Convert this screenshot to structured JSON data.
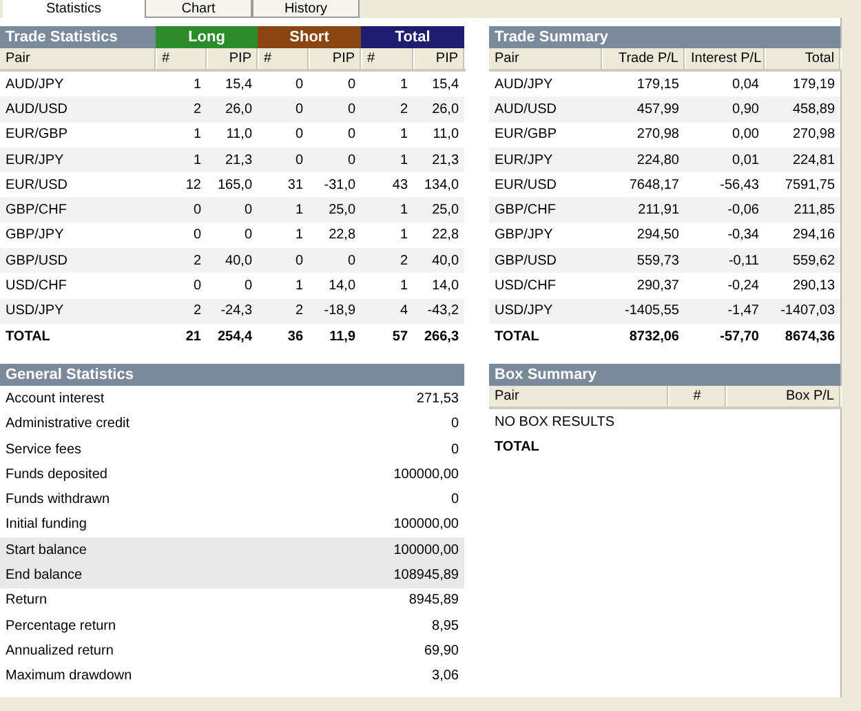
{
  "tabs": [
    {
      "label": "Statistics",
      "selected": true
    },
    {
      "label": "Chart",
      "selected": false
    },
    {
      "label": "History",
      "selected": false
    }
  ],
  "trade_statistics": {
    "title": "Trade Statistics",
    "groups": [
      {
        "label": "Long",
        "color": "#2a8c2a"
      },
      {
        "label": "Short",
        "color": "#8b4513"
      },
      {
        "label": "Total",
        "color": "#1e1e70"
      }
    ],
    "columns": [
      "Pair",
      "#",
      "PIP",
      "#",
      "PIP",
      "#",
      "PIP"
    ],
    "rows": [
      {
        "cells": [
          "AUD/JPY",
          "1",
          "15,4",
          "0",
          "0",
          "1",
          "15,4"
        ]
      },
      {
        "cells": [
          "AUD/USD",
          "2",
          "26,0",
          "0",
          "0",
          "2",
          "26,0"
        ]
      },
      {
        "cells": [
          "EUR/GBP",
          "1",
          "11,0",
          "0",
          "0",
          "1",
          "11,0"
        ]
      },
      {
        "cells": [
          "EUR/JPY",
          "1",
          "21,3",
          "0",
          "0",
          "1",
          "21,3"
        ]
      },
      {
        "cells": [
          "EUR/USD",
          "12",
          "165,0",
          "31",
          "-31,0",
          "43",
          "134,0"
        ]
      },
      {
        "cells": [
          "GBP/CHF",
          "0",
          "0",
          "1",
          "25,0",
          "1",
          "25,0"
        ]
      },
      {
        "cells": [
          "GBP/JPY",
          "0",
          "0",
          "1",
          "22,8",
          "1",
          "22,8"
        ]
      },
      {
        "cells": [
          "GBP/USD",
          "2",
          "40,0",
          "0",
          "0",
          "2",
          "40,0"
        ]
      },
      {
        "cells": [
          "USD/CHF",
          "0",
          "0",
          "1",
          "14,0",
          "1",
          "14,0"
        ]
      },
      {
        "cells": [
          "USD/JPY",
          "2",
          "-24,3",
          "2",
          "-18,9",
          "4",
          "-43,2"
        ]
      }
    ],
    "total": [
      "TOTAL",
      "21",
      "254,4",
      "36",
      "11,9",
      "57",
      "266,3"
    ]
  },
  "trade_summary": {
    "title": "Trade Summary",
    "columns": [
      "Pair",
      "Trade P/L",
      "Interest P/L",
      "Total"
    ],
    "rows": [
      {
        "cells": [
          "AUD/JPY",
          "179,15",
          "0,04",
          "179,19"
        ]
      },
      {
        "cells": [
          "AUD/USD",
          "457,99",
          "0,90",
          "458,89"
        ]
      },
      {
        "cells": [
          "EUR/GBP",
          "270,98",
          "0,00",
          "270,98"
        ]
      },
      {
        "cells": [
          "EUR/JPY",
          "224,80",
          "0,01",
          "224,81"
        ]
      },
      {
        "cells": [
          "EUR/USD",
          "7648,17",
          "-56,43",
          "7591,75"
        ]
      },
      {
        "cells": [
          "GBP/CHF",
          "211,91",
          "-0,06",
          "211,85"
        ]
      },
      {
        "cells": [
          "GBP/JPY",
          "294,50",
          "-0,34",
          "294,16"
        ]
      },
      {
        "cells": [
          "GBP/USD",
          "559,73",
          "-0,11",
          "559,62"
        ]
      },
      {
        "cells": [
          "USD/CHF",
          "290,37",
          "-0,24",
          "290,13"
        ]
      },
      {
        "cells": [
          "USD/JPY",
          "-1405,55",
          "-1,47",
          "-1407,03"
        ]
      }
    ],
    "total": [
      "TOTAL",
      "8732,06",
      "-57,70",
      "8674,36"
    ]
  },
  "general_statistics": {
    "title": "General Statistics",
    "rows": [
      {
        "label": "Account interest",
        "value": "271,53",
        "shaded": false
      },
      {
        "label": "Administrative credit",
        "value": "0",
        "shaded": false
      },
      {
        "label": "Service fees",
        "value": "0",
        "shaded": false
      },
      {
        "label": "Funds deposited",
        "value": "100000,00",
        "shaded": false
      },
      {
        "label": "Funds withdrawn",
        "value": "0",
        "shaded": false
      },
      {
        "label": "Initial funding",
        "value": "100000,00",
        "shaded": false
      },
      {
        "label": "Start balance",
        "value": "100000,00",
        "shaded": true
      },
      {
        "label": "End balance",
        "value": "108945,89",
        "shaded": true
      },
      {
        "label": "Return",
        "value": "8945,89",
        "shaded": false
      },
      {
        "label": "Percentage return",
        "value": "8,95",
        "shaded": false
      },
      {
        "label": "Annualized return",
        "value": "69,90",
        "shaded": false
      },
      {
        "label": "Maximum drawdown",
        "value": "3,06",
        "shaded": false
      }
    ]
  },
  "box_summary": {
    "title": "Box Summary",
    "columns": [
      "Pair",
      "#",
      "Box P/L"
    ],
    "message": "NO BOX RESULTS",
    "total_label": "TOTAL"
  }
}
